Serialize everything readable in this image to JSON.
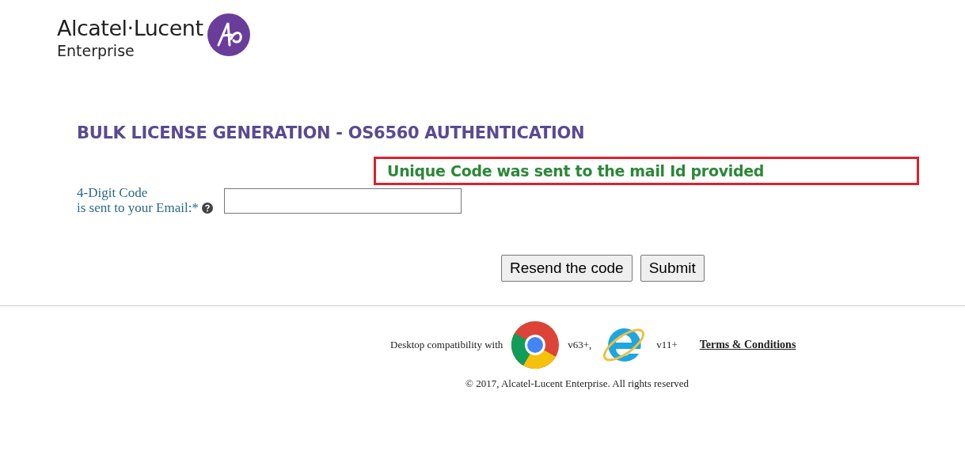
{
  "logo": {
    "brand": "Alcatel·Lucent",
    "sub": "Enterprise"
  },
  "heading": "BULK LICENSE GENERATION - OS6560 AUTHENTICATION",
  "message": "Unique Code was sent to the mail Id provided",
  "field": {
    "label_1": "4-Digit Code",
    "label_2": "is sent to your Email:*"
  },
  "buttons": [
    "Resend the code",
    "Submit"
  ],
  "footer": {
    "compat": "Desktop compatibility with",
    "chrome_version": "v63+,",
    "ie_version": "v11+",
    "terms": "Terms & Conditions",
    "copyright": "© 2017, Alcatel-Lucent Enterprise. All rights reserved"
  }
}
